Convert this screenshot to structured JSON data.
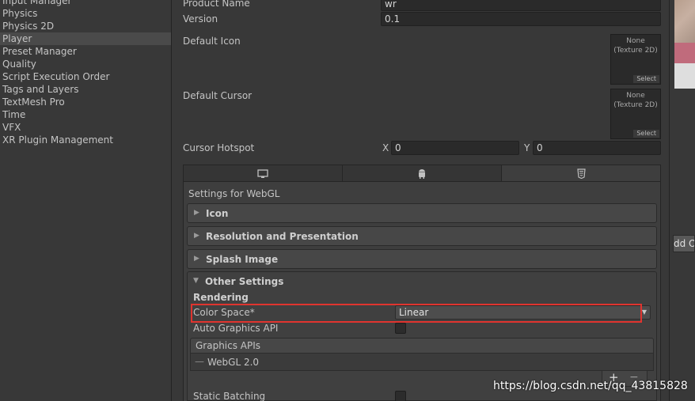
{
  "sidebar": {
    "items": [
      {
        "label": "Input Manager"
      },
      {
        "label": "Physics"
      },
      {
        "label": "Physics 2D"
      },
      {
        "label": "Player"
      },
      {
        "label": "Preset Manager"
      },
      {
        "label": "Quality"
      },
      {
        "label": "Script Execution Order"
      },
      {
        "label": "Tags and Layers"
      },
      {
        "label": "TextMesh Pro"
      },
      {
        "label": "Time"
      },
      {
        "label": "VFX"
      },
      {
        "label": "XR Plugin Management"
      }
    ],
    "selected": "Player"
  },
  "player": {
    "product_name_label": "Product Name",
    "product_name_value": "wr",
    "version_label": "Version",
    "version_value": "0.1",
    "default_icon_label": "Default Icon",
    "default_icon_none": "None",
    "default_icon_type": "(Texture 2D)",
    "default_icon_select": "Select",
    "default_cursor_label": "Default Cursor",
    "default_cursor_none": "None",
    "default_cursor_type": "(Texture 2D)",
    "default_cursor_select": "Select",
    "cursor_hotspot_label": "Cursor Hotspot",
    "hotspot_x_label": "X",
    "hotspot_x_value": "0",
    "hotspot_y_label": "Y",
    "hotspot_y_value": "0"
  },
  "platform_tabs": {
    "icons": [
      "monitor-icon",
      "android-icon",
      "html5-icon"
    ],
    "active": "html5-icon"
  },
  "webgl": {
    "settings_for": "Settings for WebGL",
    "sections": [
      {
        "title": "Icon",
        "expanded": false
      },
      {
        "title": "Resolution and Presentation",
        "expanded": false
      },
      {
        "title": "Splash Image",
        "expanded": false
      },
      {
        "title": "Other Settings",
        "expanded": true
      }
    ],
    "rendering_label": "Rendering",
    "color_space_label": "Color Space*",
    "color_space_value": "Linear",
    "auto_graphics_label": "Auto Graphics API",
    "graphics_apis_label": "Graphics APIs",
    "graphics_api_item": "WebGL 2.0",
    "add_symbol": "+",
    "remove_symbol": "−",
    "static_batching_label": "Static Batching"
  },
  "right_panel": {
    "add_button_label": "dd O"
  },
  "watermark": "https://blog.csdn.net/qq_43815828",
  "colors": {
    "background": "#383838",
    "selected_row": "#4a4a4a",
    "highlight": "#e0342f"
  }
}
